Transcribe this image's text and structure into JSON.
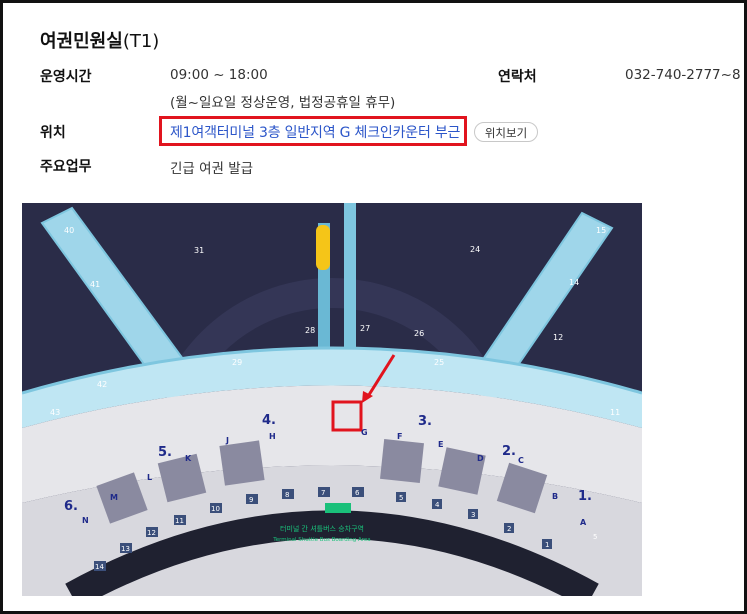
{
  "office": {
    "title": "여권민원실",
    "title_suffix": "(T1)"
  },
  "info": {
    "hours_label": "운영시간",
    "hours_value": "09:00 ~ 18:00",
    "hours_note": "(월~일요일 정상운영, 법정공휴일 휴무)",
    "contact_label": "연락처",
    "contact_value": "032-740-2777~8",
    "location_label": "위치",
    "location_value": "제1여객터미널 3층 일반지역 G 체크인카운터 부근",
    "location_button": "위치보기",
    "duty_label": "주요업무",
    "duty_value": "긴급 여권 발급"
  },
  "map": {
    "gates": [
      "40",
      "31",
      "41",
      "42",
      "43",
      "29",
      "28",
      "27",
      "26",
      "25",
      "24",
      "15",
      "14",
      "12",
      "11"
    ],
    "zone_numbers": [
      "1.",
      "2.",
      "3.",
      "4.",
      "5.",
      "6."
    ],
    "counters": [
      "A",
      "B",
      "C",
      "D",
      "E",
      "F",
      "G",
      "H",
      "J",
      "K",
      "L",
      "M",
      "N"
    ],
    "bus_label_ko": "터미널 간 셔틀버스 승차구역",
    "bus_label_en": "Terminal Shuttle Bus Boarding Area",
    "exit_numbers": [
      "1",
      "2",
      "3",
      "4",
      "5",
      "6",
      "7",
      "8",
      "9",
      "10",
      "11",
      "12",
      "13",
      "14"
    ],
    "extra_gate": "5",
    "accent_color": "#e1141e",
    "text_color": "#2c56c9"
  }
}
